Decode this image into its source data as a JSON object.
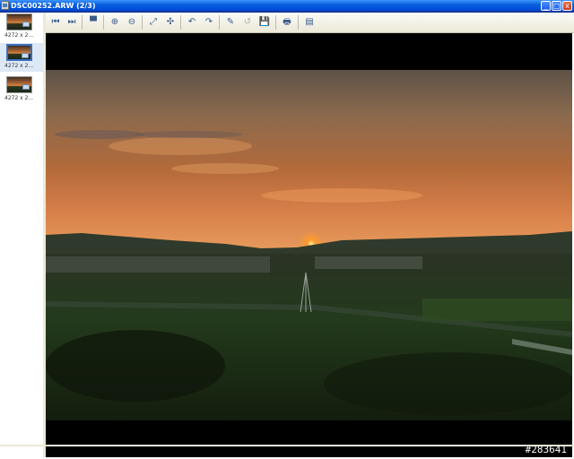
{
  "window": {
    "title": "DSC00252.ARW  (2/3)"
  },
  "window_buttons": {
    "minimize": "_",
    "maximize": "□",
    "close": "x"
  },
  "thumbnails": [
    {
      "caption": "4272 x 2...",
      "selected": false
    },
    {
      "caption": "4272 x 2...",
      "selected": true
    },
    {
      "caption": "4272 x 2...",
      "selected": false
    }
  ],
  "toolbar": {
    "icons": [
      "first-image-icon",
      "last-image-icon",
      "fit-window-icon",
      "zoom-in-icon",
      "zoom-out-icon",
      "full-screen-icon",
      "actual-size-icon",
      "rotate-left-icon",
      "rotate-right-icon",
      "undo-icon",
      "save-icon",
      "edit-icon",
      "print-icon",
      "properties-icon"
    ],
    "glyphs": [
      "⏮",
      "⏭",
      "▀",
      "⊕",
      "⊖",
      "⤢",
      "✣",
      "↶",
      "↷",
      "↺",
      "💾",
      "✎",
      "🖶",
      "▤"
    ]
  },
  "watermark": "#283641"
}
